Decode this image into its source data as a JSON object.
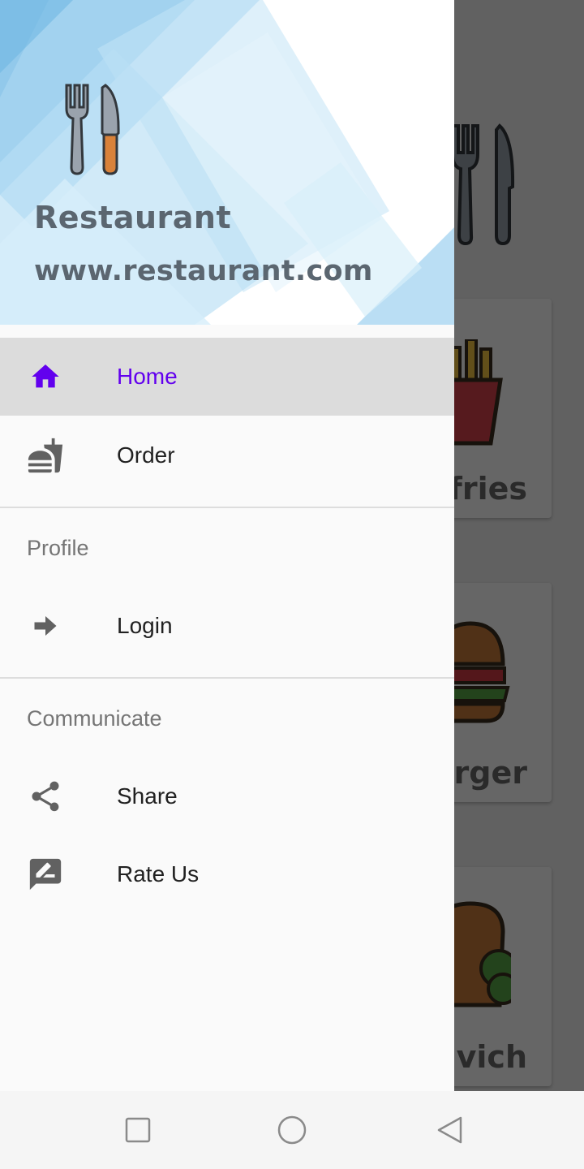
{
  "app": {
    "cards": [
      {
        "label": "fries"
      },
      {
        "label": "rger"
      },
      {
        "label": "vich"
      }
    ]
  },
  "drawer": {
    "header": {
      "title": "Restaurant",
      "url": "www.restaurant.com",
      "logo_icon": "fork-knife-icon"
    },
    "items": [
      {
        "label": "Home",
        "icon": "home-icon",
        "selected": true
      },
      {
        "label": "Order",
        "icon": "fastfood-icon",
        "selected": false
      }
    ],
    "sections": [
      {
        "title": "Profile",
        "items": [
          {
            "label": "Login",
            "icon": "arrow-right-icon"
          }
        ]
      },
      {
        "title": "Communicate",
        "items": [
          {
            "label": "Share",
            "icon": "share-icon"
          },
          {
            "label": "Rate Us",
            "icon": "rate-review-icon"
          }
        ]
      }
    ]
  },
  "navbar": {
    "buttons": [
      "recent-apps-icon",
      "home-circle-icon",
      "back-triangle-icon"
    ]
  },
  "colors": {
    "accent": "#6200ee",
    "icon_gray": "#616161",
    "selected_bg": "#dcdcdc",
    "header_text": "#5b6670"
  }
}
